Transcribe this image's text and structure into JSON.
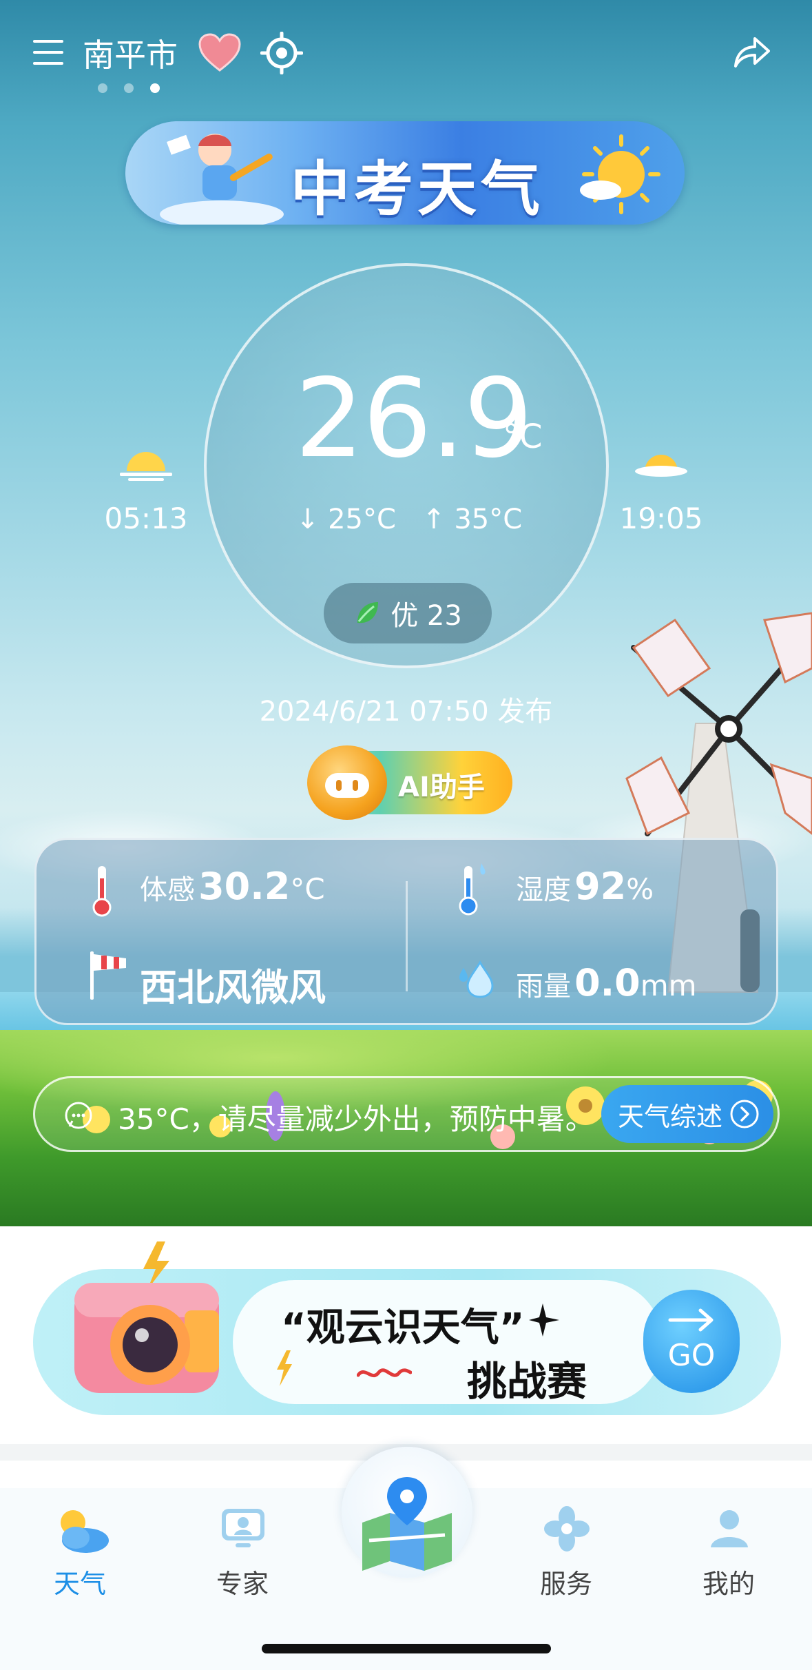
{
  "header": {
    "city": "南平市",
    "page_dots": 3,
    "active_dot": 2
  },
  "banner": {
    "title": "中考天气"
  },
  "weather": {
    "temperature": "26.9",
    "temp_unit": "°C",
    "low": "25°C",
    "high": "35°C",
    "aqi_label": "优 23",
    "sunrise": "05:13",
    "sunset": "19:05",
    "published": "2024/6/21 07:50 发布"
  },
  "ai": {
    "label": "AI助手"
  },
  "details": {
    "feels_like_label": "体感",
    "feels_like_value": "30.2",
    "feels_like_unit": "°C",
    "humidity_label": "湿度",
    "humidity_value": "92",
    "humidity_unit": "%",
    "wind": "西北风微风",
    "rain_label": "雨量",
    "rain_value": "0.0",
    "rain_unit": "mm"
  },
  "tip": {
    "text": "35°C，请尽量减少外出，预防中暑。",
    "button": "天气综述"
  },
  "challenge": {
    "line1": "“观云识天气”",
    "line2": "挑战赛",
    "go": "GO"
  },
  "tabs": [
    {
      "label": "天气",
      "icon": "weather-icon",
      "active": true
    },
    {
      "label": "专家",
      "icon": "expert-icon",
      "active": false
    },
    {
      "label": "服务",
      "icon": "service-icon",
      "active": false
    },
    {
      "label": "我的",
      "icon": "profile-icon",
      "active": false
    }
  ],
  "colors": {
    "accent": "#1d8fe6",
    "aqi_leaf": "#3fb950"
  }
}
